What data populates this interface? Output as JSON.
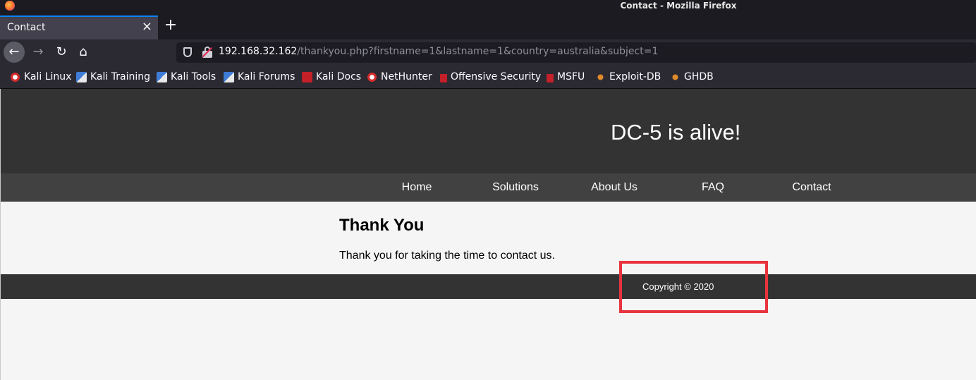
{
  "window": {
    "title": "Contact - Mozilla Firefox"
  },
  "tab": {
    "label": "Contact",
    "close_symbol": "×",
    "new_tab_symbol": "+"
  },
  "nav": {
    "back_symbol": "←",
    "forward_symbol": "→",
    "reload_symbol": "↻",
    "home_symbol": "⌂",
    "url_host": "192.168.32.162",
    "url_path": "/thankyou.php?firstname=1&lastname=1&country=australia&subject=1"
  },
  "bookmarks": [
    {
      "label": "Kali Linux",
      "icon": "kali-dragon-icon"
    },
    {
      "label": "Kali Training",
      "icon": "kali-training-icon"
    },
    {
      "label": "Kali Tools",
      "icon": "kali-tools-icon"
    },
    {
      "label": "Kali Forums",
      "icon": "kali-forums-icon"
    },
    {
      "label": "Kali Docs",
      "icon": "kali-docs-icon"
    },
    {
      "label": "NetHunter",
      "icon": "nethunter-icon"
    },
    {
      "label": "Offensive Security",
      "icon": "offsec-icon"
    },
    {
      "label": "MSFU",
      "icon": "msfu-icon"
    },
    {
      "label": "Exploit-DB",
      "icon": "exploit-db-icon"
    },
    {
      "label": "GHDB",
      "icon": "ghdb-icon"
    }
  ],
  "site": {
    "title": "DC-5 is alive!",
    "nav": [
      "Home",
      "Solutions",
      "About Us",
      "FAQ",
      "Contact"
    ],
    "heading": "Thank You",
    "message": "Thank you for taking the time to contact us.",
    "footer": "Copyright © 2020"
  },
  "colors": {
    "header_bg": "#333333",
    "nav_bg": "#414141",
    "page_bg": "#f5f5f5",
    "highlight_box": "#e8343f"
  }
}
